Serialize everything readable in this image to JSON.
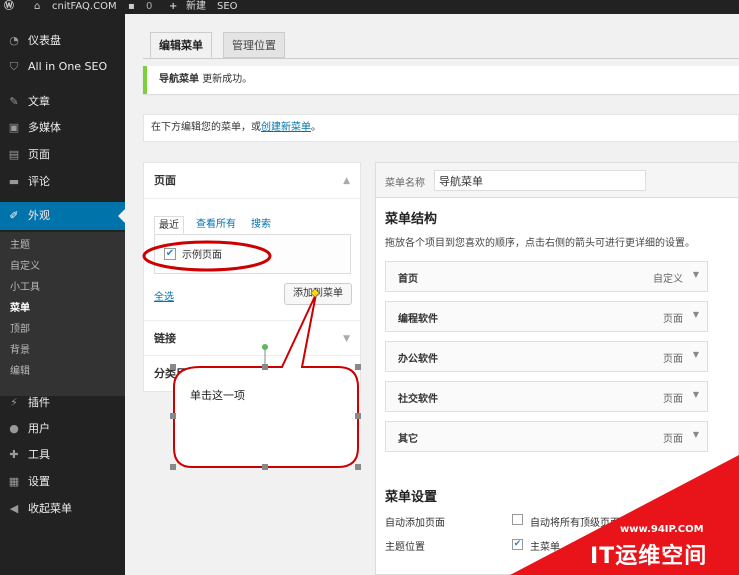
{
  "admin_bar": {
    "logo_icon": "wordpress-logo",
    "home_icon": "home-icon",
    "site_name": "cnitFAQ.COM",
    "comment_icon": "comment-icon",
    "comment_count": "0",
    "plus_icon": "plus-icon",
    "new_label": "新建",
    "seo_label": "SEO"
  },
  "sidebar": {
    "items": [
      {
        "icon": "dashboard-icon",
        "label": "仪表盘"
      },
      {
        "icon": "shield-icon",
        "label": "All in One SEO"
      },
      {
        "icon": "pin-icon",
        "label": "文章"
      },
      {
        "icon": "media-icon",
        "label": "多媒体"
      },
      {
        "icon": "page-icon",
        "label": "页面"
      },
      {
        "icon": "comment-icon",
        "label": "评论"
      },
      {
        "icon": "brush-icon",
        "label": "外观"
      },
      {
        "icon": "plugin-icon",
        "label": "插件"
      },
      {
        "icon": "user-icon",
        "label": "用户"
      },
      {
        "icon": "wrench-icon",
        "label": "工具"
      },
      {
        "icon": "settings-icon",
        "label": "设置"
      },
      {
        "icon": "collapse-icon",
        "label": "收起菜单"
      }
    ],
    "submenu": [
      "主题",
      "自定义",
      "小工具",
      "菜单",
      "顶部",
      "背景",
      "编辑"
    ],
    "current_submenu": "菜单"
  },
  "tabs": [
    "编辑菜单",
    "管理位置"
  ],
  "notice": {
    "bold": "导航菜单",
    "rest": "更新成功。"
  },
  "manage": {
    "prefix": "在下方编辑您的菜单，或",
    "link": "创建新菜单",
    "suffix": "。"
  },
  "left_panel": {
    "pages_title": "页面",
    "inner_tabs": [
      "最近",
      "查看所有",
      "搜索"
    ],
    "item_label": "示例页面",
    "item_checked": true,
    "select_all": "全选",
    "add_button": "添加到菜单",
    "links_title": "链接",
    "categories_title": "分类目录"
  },
  "right_panel": {
    "menu_name_label": "菜单名称",
    "menu_name_value": "导航菜单",
    "structure_title": "菜单结构",
    "structure_desc": "拖放各个项目到您喜欢的顺序，点击右侧的箭头可进行更详细的设置。",
    "items": [
      {
        "title": "首页",
        "type": "自定义"
      },
      {
        "title": "编程软件",
        "type": "页面"
      },
      {
        "title": "办公软件",
        "type": "页面"
      },
      {
        "title": "社交软件",
        "type": "页面"
      },
      {
        "title": "其它",
        "type": "页面"
      }
    ],
    "settings_title": "菜单设置",
    "auto_add_label": "自动添加页面",
    "auto_add_option": "自动将所有顶级页面",
    "auto_add_checked": false,
    "location_label": "主题位置",
    "location_option": "主菜单",
    "location_checked": true
  },
  "callout_text": "单击这一项",
  "watermark": {
    "url": "www.94IP.COM",
    "text": "IT运维空间"
  },
  "colors": {
    "sidebar": "#222222",
    "accent": "#0073aa",
    "annotation": "#cc0000",
    "watermark": "#e8141a"
  }
}
